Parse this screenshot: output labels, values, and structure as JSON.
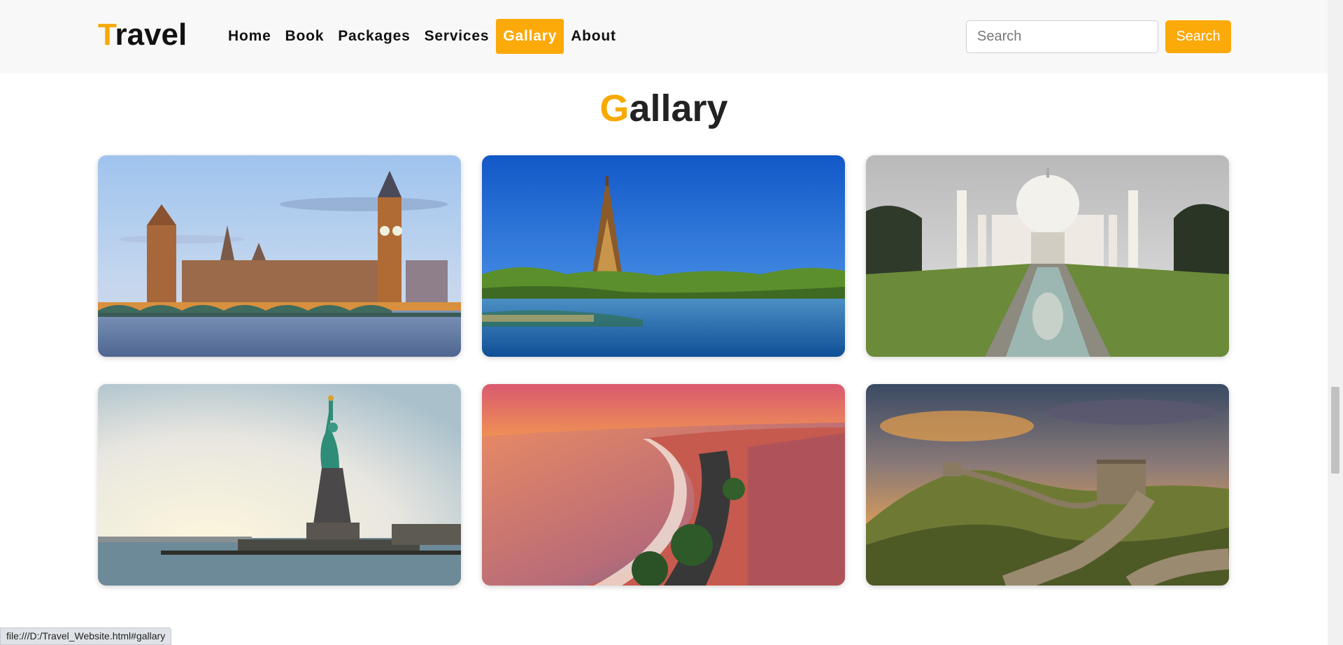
{
  "brand": {
    "first_letter": "T",
    "rest": "ravel"
  },
  "nav": {
    "items": [
      {
        "label": "Home"
      },
      {
        "label": "Book"
      },
      {
        "label": "Packages"
      },
      {
        "label": "Services"
      },
      {
        "label": "Gallary",
        "active": true
      },
      {
        "label": "About"
      }
    ]
  },
  "search": {
    "placeholder": "Search",
    "value": "",
    "button_label": "Search"
  },
  "section": {
    "title_first_letter": "G",
    "title_rest": "allary"
  },
  "gallery": {
    "images": [
      {
        "subject": "London - Houses of Parliament and Big Ben"
      },
      {
        "subject": "Paris - Eiffel Tower over the Seine"
      },
      {
        "subject": "Agra - Taj Mahal with reflecting pool"
      },
      {
        "subject": "New York - Statue of Liberty"
      },
      {
        "subject": "Nice - coastline at sunset"
      },
      {
        "subject": "Great Wall of China"
      }
    ]
  },
  "status_bar": {
    "url": "file:///D:/Travel_Website.html#gallary"
  },
  "colors": {
    "accent": "#fca90a",
    "navbar_bg": "#f8f8f8",
    "text": "#111111"
  }
}
